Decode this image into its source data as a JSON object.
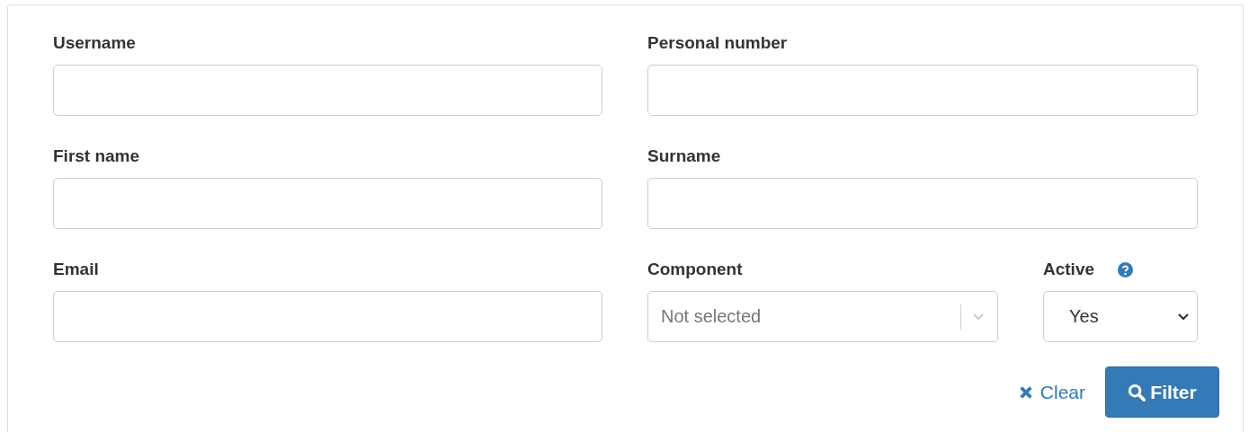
{
  "fields": [
    {
      "kind": "text",
      "label": "Username"
    },
    {
      "kind": "text",
      "label": "Personal number"
    },
    {
      "kind": "text",
      "label": "First name"
    },
    {
      "kind": "text",
      "label": "Surname"
    },
    {
      "kind": "text",
      "label": "Email"
    },
    {
      "kind": "combo",
      "label": "Component",
      "placeholder": "Not selected"
    },
    {
      "kind": "select",
      "label": "Active",
      "value": "Yes",
      "help": true
    }
  ],
  "buttons": [
    {
      "kind": "link",
      "label": "Clear"
    },
    {
      "kind": "primary",
      "label": "Filter"
    }
  ]
}
